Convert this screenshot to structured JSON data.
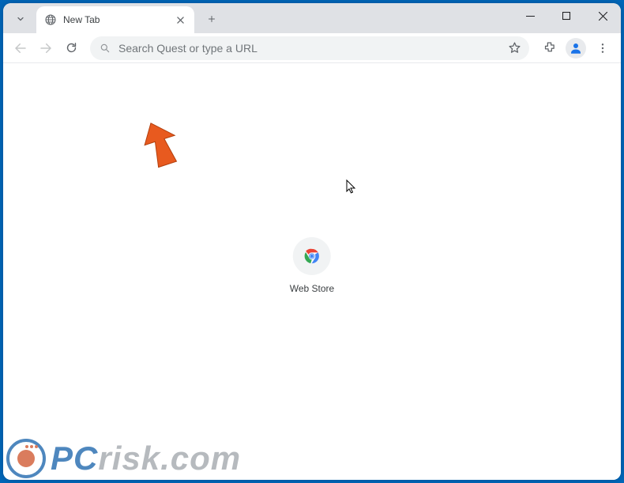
{
  "tab": {
    "title": "New Tab"
  },
  "omnibox": {
    "placeholder": "Search Quest or type a URL"
  },
  "shortcuts": {
    "webstore_label": "Web Store"
  },
  "watermark": {
    "prefix": "PC",
    "suffix": "risk.com"
  }
}
